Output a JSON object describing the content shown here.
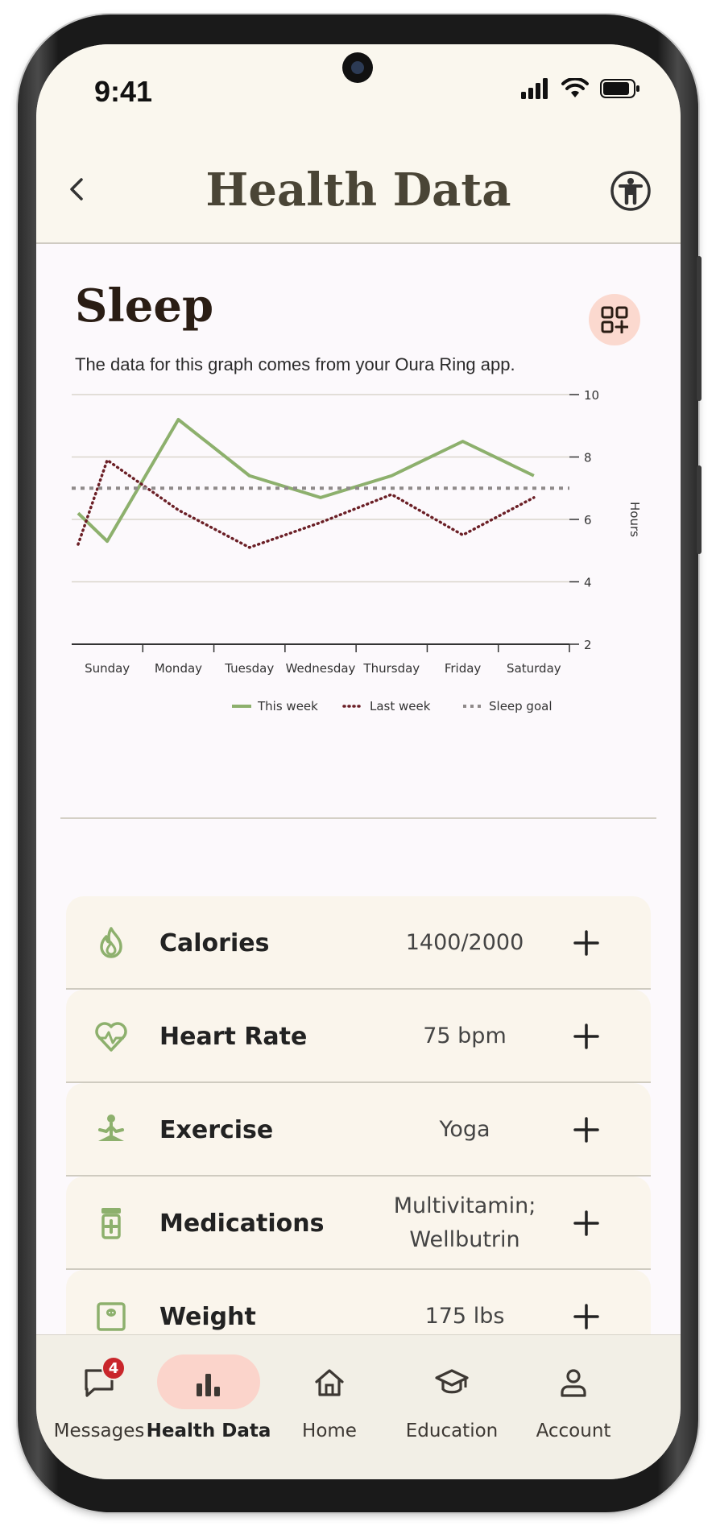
{
  "status_bar": {
    "time": "9:41"
  },
  "header": {
    "title": "Health Data"
  },
  "sleep": {
    "title": "Sleep",
    "subtitle": "The data for this graph comes from your Oura Ring app."
  },
  "chart_data": {
    "type": "line",
    "categories": [
      "Sunday",
      "Monday",
      "Tuesday",
      "Wednesday",
      "Thursday",
      "Friday",
      "Saturday"
    ],
    "series": [
      {
        "name": "This week",
        "values": [
          5.3,
          9.2,
          7.4,
          6.7,
          7.4,
          8.5,
          7.4
        ],
        "start_value": 6.2,
        "color": "#8db06d",
        "style": "solid"
      },
      {
        "name": "Last week",
        "values": [
          7.9,
          6.3,
          5.1,
          5.9,
          6.8,
          5.5,
          6.7
        ],
        "start_value": 5.2,
        "color": "#6b1f26",
        "style": "dotted"
      },
      {
        "name": "Sleep goal",
        "values": [
          7,
          7,
          7,
          7,
          7,
          7,
          7
        ],
        "color": "#8f8a8a",
        "style": "dashed"
      }
    ],
    "ylabel": "Hours",
    "ylim": [
      2,
      10
    ],
    "yticks": [
      "2",
      "4",
      "6",
      "8",
      "10"
    ],
    "grid": true,
    "legend_position": "bottom"
  },
  "metrics": [
    {
      "name": "Calories",
      "value": "1400/2000",
      "icon": "flame-icon"
    },
    {
      "name": "Heart Rate",
      "value": "75 bpm",
      "icon": "heart-pulse-icon"
    },
    {
      "name": "Exercise",
      "value": "Yoga",
      "icon": "yoga-icon"
    },
    {
      "name": "Medications",
      "value": "Multivitamin;\nWellbutrin",
      "icon": "pill-bottle-icon"
    },
    {
      "name": "Weight",
      "value": "175 lbs",
      "icon": "scale-icon"
    }
  ],
  "nav": {
    "items": [
      {
        "label": "Messages",
        "icon": "message-icon",
        "badge": "4"
      },
      {
        "label": "Health Data",
        "icon": "bar-chart-icon"
      },
      {
        "label": "Home",
        "icon": "home-icon"
      },
      {
        "label": "Education",
        "icon": "graduation-cap-icon"
      },
      {
        "label": "Account",
        "icon": "person-icon"
      }
    ],
    "active": "Health Data"
  },
  "colors": {
    "accent_green": "#8db06d",
    "accent_pink": "#fbd4cb",
    "dark_red": "#6b1f26",
    "cream": "#faf5ec"
  }
}
